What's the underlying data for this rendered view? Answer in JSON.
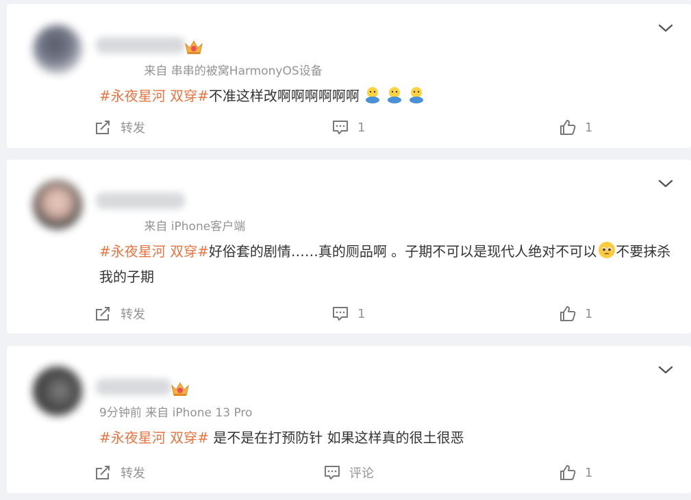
{
  "colors": {
    "topic": "#eb7340",
    "meta": "#939393",
    "text": "#333333",
    "background": "#f1f2f5"
  },
  "posts": [
    {
      "has_badge": true,
      "time": "",
      "source": "来自 串串的被窝HarmonyOS设备",
      "topic": "#永夜星河 双穿#",
      "text": "不准这样改啊啊啊啊啊啊",
      "emojis": [
        "blue-hug-emoji",
        "blue-hug-emoji",
        "blue-hug-emoji"
      ],
      "actions": {
        "repost": "转发",
        "comment": "1",
        "like": "1"
      }
    },
    {
      "has_badge": false,
      "time": "",
      "source": "来自 iPhone客户端",
      "topic": "#永夜星河 双穿#",
      "text": "好俗套的剧情……真的厕品啊 。子期不可以是现代人绝对不可以",
      "text_after_emoji": "不要抹杀我的子期",
      "emojis": [
        "pleading-face-emoji"
      ],
      "actions": {
        "repost": "转发",
        "comment": "1",
        "like": "1"
      }
    },
    {
      "has_badge": true,
      "time": "9分钟前",
      "source": "来自 iPhone 13 Pro",
      "topic": "#永夜星河 双穿#",
      "text": " 是不是在打预防针 如果这样真的很土很恶",
      "actions": {
        "repost": "转发",
        "comment": "评论",
        "like": "1"
      }
    }
  ]
}
